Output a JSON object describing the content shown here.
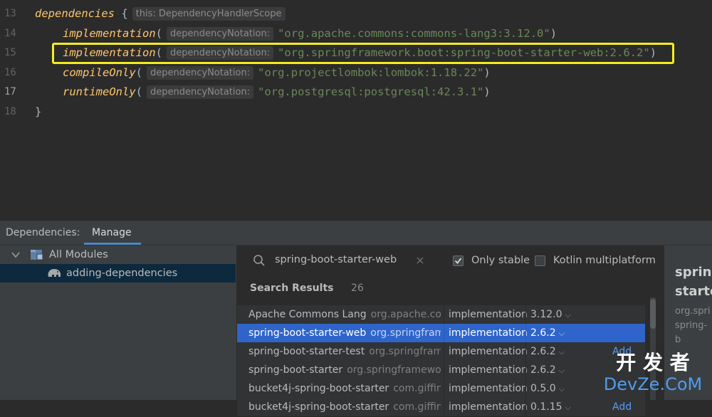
{
  "editor": {
    "lines": [
      {
        "num": "13",
        "keyword": "dependencies",
        "brace": " {",
        "hint": "this: DependencyHandlerScope"
      },
      {
        "num": "14",
        "keyword": "implementation",
        "hint": "dependencyNotation:",
        "value": "\"org.apache.commons:commons-lang3:3.12.0\""
      },
      {
        "num": "15",
        "keyword": "implementation",
        "hint": "dependencyNotation:",
        "value": "\"org.springframework.boot:spring-boot-starter-web:2.6.2\""
      },
      {
        "num": "16",
        "keyword": "compileOnly",
        "hint": "dependencyNotation:",
        "value": "\"org.projectlombok:lombok:1.18.22\""
      },
      {
        "num": "17",
        "keyword": "runtimeOnly",
        "hint": "dependencyNotation:",
        "value": "\"org.postgresql:postgresql:42.3.1\""
      },
      {
        "num": "18",
        "brace": "}"
      }
    ]
  },
  "tool_window": {
    "label": "Dependencies:",
    "tab": "Manage"
  },
  "modules": {
    "root": "All Modules",
    "child": "adding-dependencies"
  },
  "search": {
    "query": "spring-boot-starter-web",
    "only_stable_label": "Only stable",
    "only_stable_checked": true,
    "kotlin_mp_label": "Kotlin multiplatform",
    "kotlin_mp_checked": false,
    "results_label": "Search Results",
    "results_count": "26"
  },
  "results": [
    {
      "name": "Apache Commons Lang",
      "group": "org.apache.commons",
      "config": "implementation",
      "version": "3.12.0",
      "add": ""
    },
    {
      "name": "spring-boot-starter-web",
      "group": "org.springframework.boot",
      "config": "implementation",
      "version": "2.6.2",
      "add": ""
    },
    {
      "name": "spring-boot-starter-test",
      "group": "org.springframework.boot",
      "config": "implementation",
      "version": "2.6.2",
      "add": "Add"
    },
    {
      "name": "spring-boot-starter",
      "group": "org.springframework.boot",
      "config": "implementation",
      "version": "2.6.2",
      "add": ""
    },
    {
      "name": "bucket4j-spring-boot-starter",
      "group": "com.giffing",
      "config": "implementation",
      "version": "0.5.0",
      "add": ""
    },
    {
      "name": "bucket4j-spring-boot-starter",
      "group": "com.giffing",
      "config": "implementation",
      "version": "0.1.15",
      "add": "Add"
    }
  ],
  "details": {
    "title_line1": "sprin",
    "title_line2": "starte",
    "group_line1": "org.spri",
    "group_line2": "spring-b"
  },
  "watermark": {
    "cn": "开 发 者",
    "en": "DevZe.CoM"
  },
  "colors": {
    "highlight": "#f4ec1f",
    "selection": "#2f65ca",
    "link": "#589df6"
  }
}
